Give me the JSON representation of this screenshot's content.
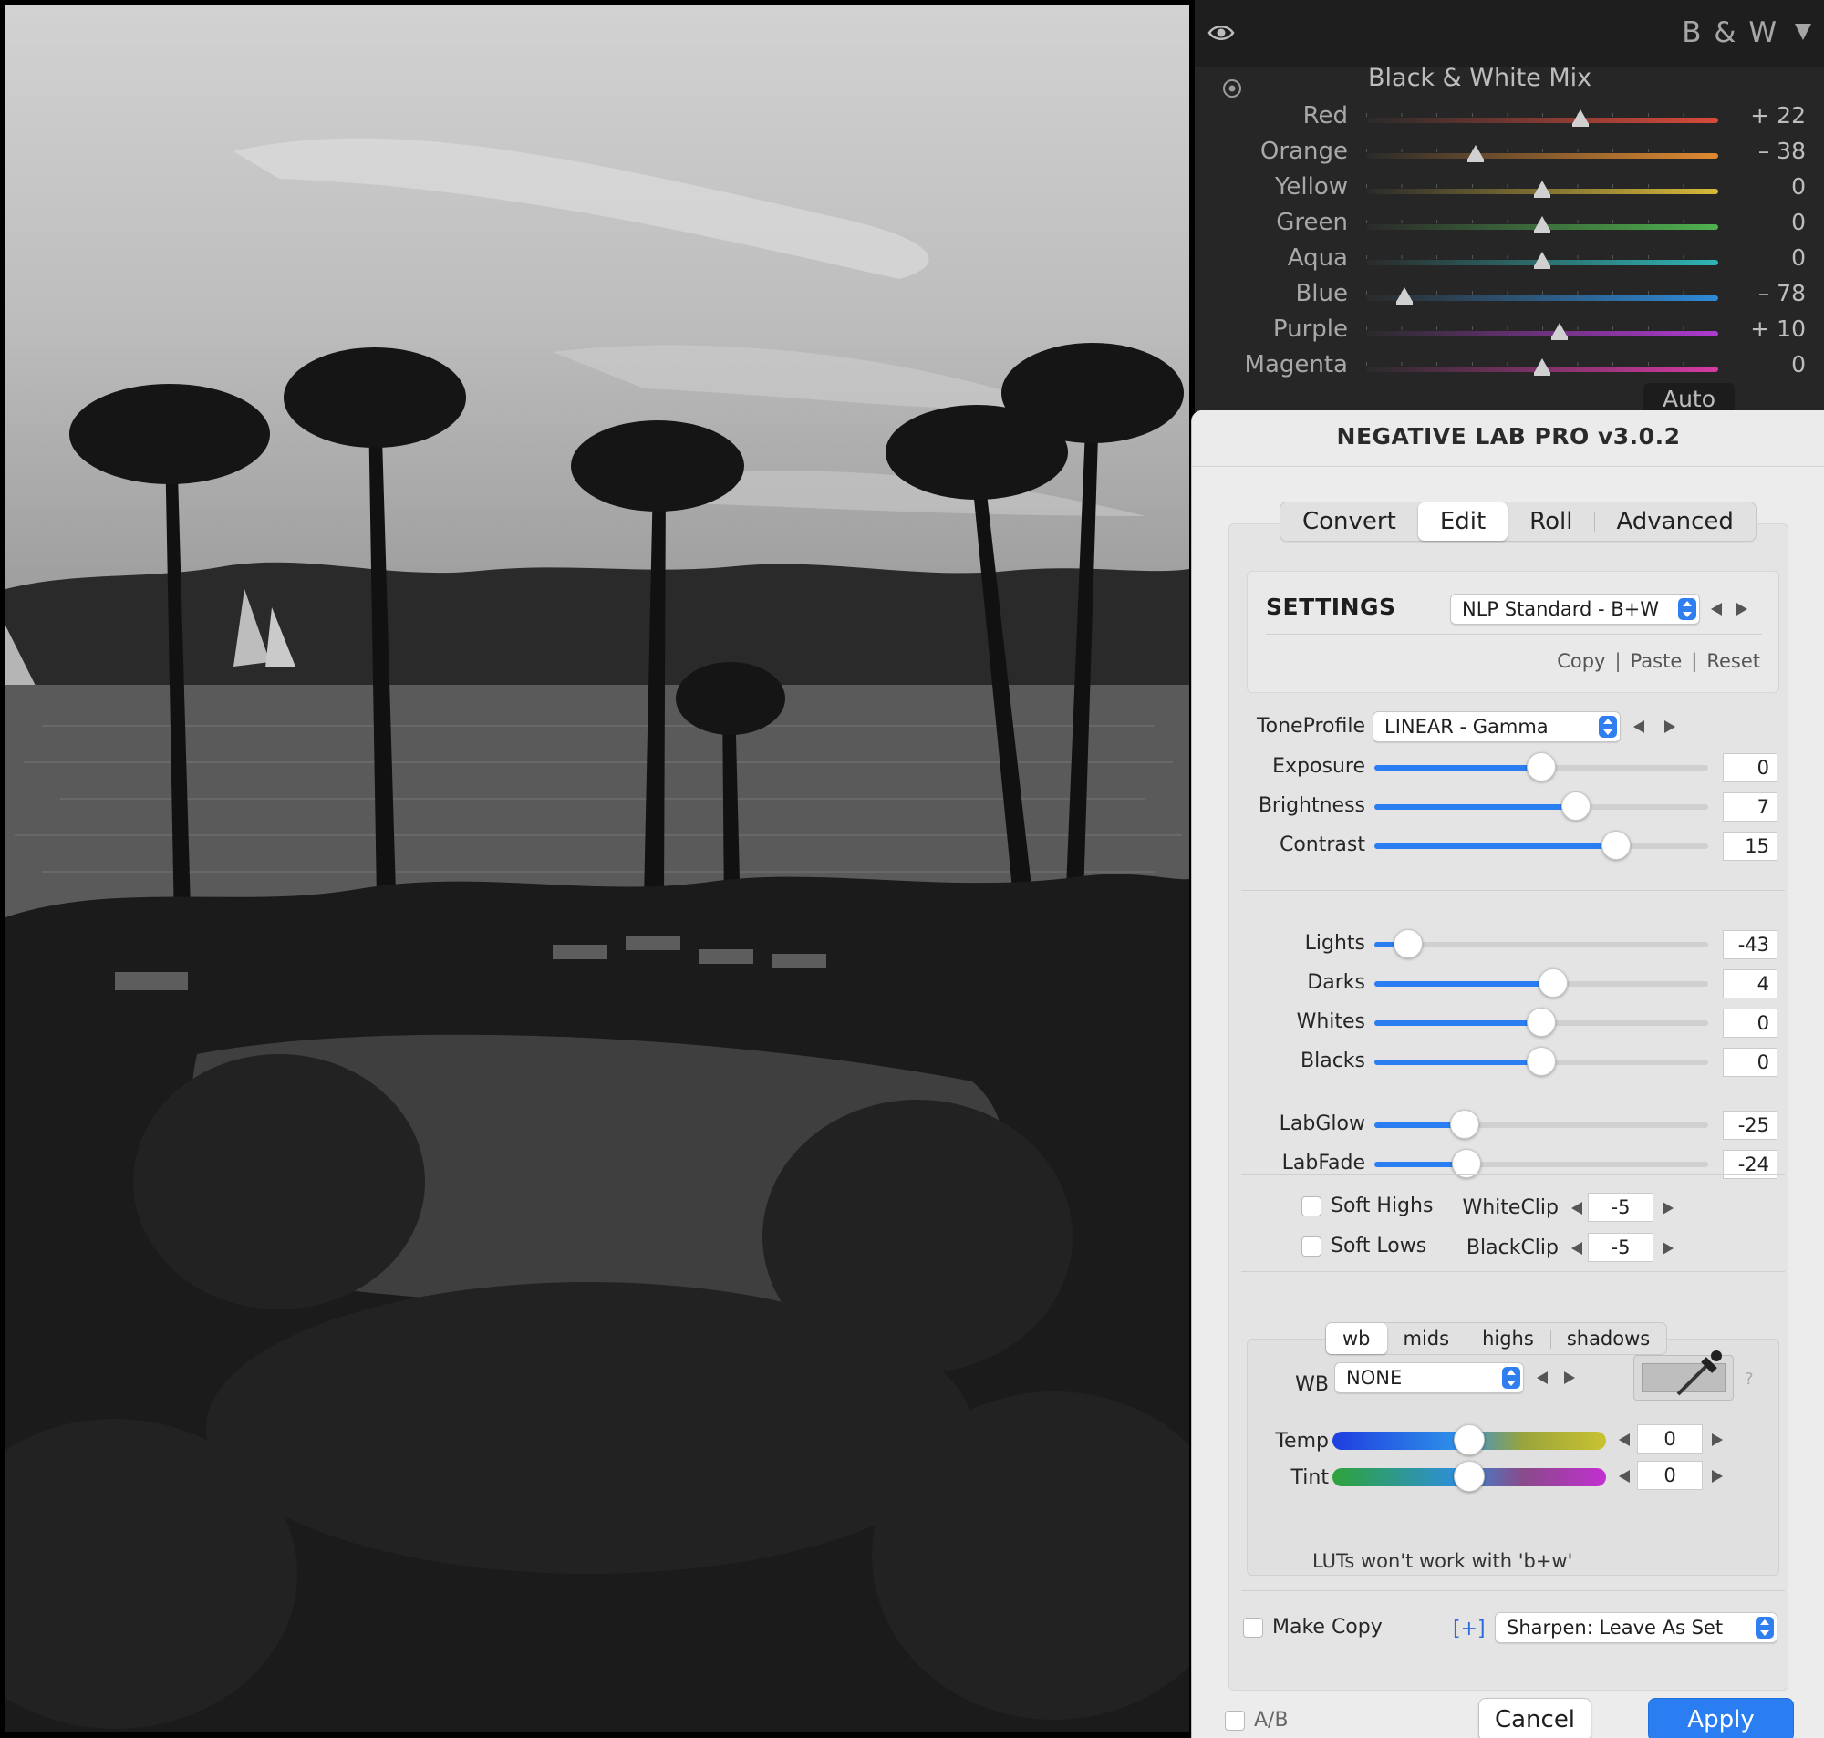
{
  "bw_panel": {
    "title": "B & W",
    "mix_title": "Black & White Mix",
    "auto_label": "Auto",
    "mix": [
      {
        "label": "Red",
        "value_text": "+ 22",
        "value": 22,
        "color": "#d84a3a"
      },
      {
        "label": "Orange",
        "value_text": "– 38",
        "value": -38,
        "color": "#e08a30"
      },
      {
        "label": "Yellow",
        "value_text": "0",
        "value": 0,
        "color": "#d7b93a"
      },
      {
        "label": "Green",
        "value_text": "0",
        "value": 0,
        "color": "#4fb34f"
      },
      {
        "label": "Aqua",
        "value_text": "0",
        "value": 0,
        "color": "#2fb5b5"
      },
      {
        "label": "Blue",
        "value_text": "– 78",
        "value": -78,
        "color": "#2f8ad8"
      },
      {
        "label": "Purple",
        "value_text": "+ 10",
        "value": 10,
        "color": "#b03ad0"
      },
      {
        "label": "Magenta",
        "value_text": "0",
        "value": 0,
        "color": "#d63aa5"
      }
    ]
  },
  "dialog": {
    "title": "NEGATIVE LAB PRO v3.0.2",
    "tabs": [
      "Convert",
      "Edit",
      "Roll",
      "Advanced"
    ],
    "active_tab": "Edit",
    "settings": {
      "label": "SETTINGS",
      "preset": "NLP Standard - B+W",
      "copy": "Copy",
      "paste": "Paste",
      "reset": "Reset"
    },
    "tone_profile": {
      "label": "ToneProfile",
      "value": "LINEAR - Gamma"
    },
    "sliders_group1": [
      {
        "label": "Exposure",
        "value": "0",
        "fraction": 0.5
      },
      {
        "label": "Brightness",
        "value": "7",
        "fraction": 0.605
      },
      {
        "label": "Contrast",
        "value": "15",
        "fraction": 0.725
      }
    ],
    "sliders_group2": [
      {
        "label": "Lights",
        "value": "-43",
        "fraction": 0.1
      },
      {
        "label": "Darks",
        "value": "4",
        "fraction": 0.535
      },
      {
        "label": "Whites",
        "value": "0",
        "fraction": 0.5
      },
      {
        "label": "Blacks",
        "value": "0",
        "fraction": 0.5
      }
    ],
    "sliders_group3": [
      {
        "label": "LabGlow",
        "value": "-25",
        "fraction": 0.27
      },
      {
        "label": "LabFade",
        "value": "-24",
        "fraction": 0.275
      }
    ],
    "soft_highs": "Soft Highs",
    "soft_lows": "Soft Lows",
    "white_clip": {
      "label": "WhiteClip",
      "value": "-5"
    },
    "black_clip": {
      "label": "BlackClip",
      "value": "-5"
    },
    "color_tabs": [
      "wb",
      "mids",
      "highs",
      "shadows"
    ],
    "active_color_tab": "wb",
    "wb": {
      "label": "WB",
      "value": "NONE",
      "help": "?"
    },
    "temp": {
      "label": "Temp",
      "value": "0",
      "fraction": 0.5
    },
    "tint": {
      "label": "Tint",
      "value": "0",
      "fraction": 0.5
    },
    "lut_note": "LUTs won't work with 'b+w'",
    "make_copy": "Make Copy",
    "plus_label": "[+]",
    "sharpen": "Sharpen: Leave As Set",
    "ab_label": "A/B",
    "cancel": "Cancel",
    "apply": "Apply",
    "accent_color": "#2b7ef2"
  }
}
